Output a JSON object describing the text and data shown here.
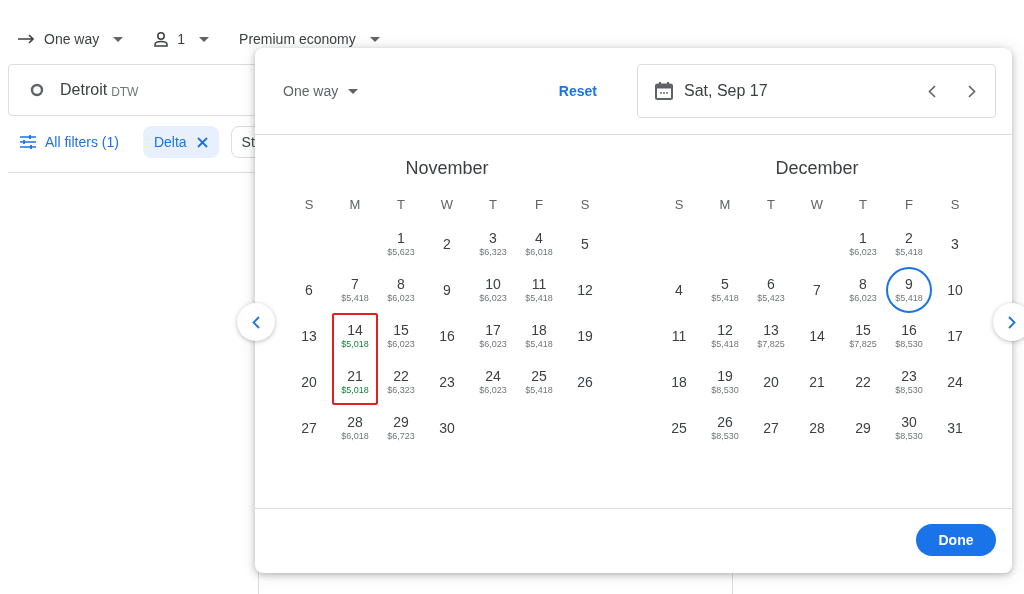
{
  "top_bar": {
    "trip_type": "One way",
    "passengers": "1",
    "cabin": "Premium economy"
  },
  "origin": {
    "city": "Detroit",
    "code": "DTW"
  },
  "filters": {
    "all_filters": "All filters (1)",
    "chips": [
      {
        "label": "Delta",
        "removable": true
      },
      {
        "label": "St",
        "removable": false
      }
    ]
  },
  "dialog": {
    "trip_type": "One way",
    "reset": "Reset",
    "date": "Sat, Sep 17",
    "done": "Done",
    "months": [
      {
        "name": "November",
        "weekdays": [
          "S",
          "M",
          "T",
          "W",
          "T",
          "F",
          "S"
        ],
        "weeks": [
          {
            "kind": "first",
            "days": [
              {
                "day": "1",
                "price": "$5,623",
                "cheap": false,
                "selected": false,
                "highlighted": false
              },
              {
                "day": "2",
                "selected": false,
                "highlighted": false
              },
              {
                "day": "3",
                "price": "$6,323",
                "cheap": false,
                "selected": false,
                "highlighted": false
              },
              {
                "day": "4",
                "price": "$6,018",
                "cheap": false,
                "selected": false,
                "highlighted": false
              },
              {
                "day": "5",
                "selected": false,
                "highlighted": false
              }
            ]
          },
          {
            "kind": "full",
            "days": [
              {
                "day": "6",
                "selected": false,
                "highlighted": false
              },
              {
                "day": "7",
                "price": "$5,418",
                "cheap": false,
                "selected": false,
                "highlighted": false
              },
              {
                "day": "8",
                "price": "$6,023",
                "cheap": false,
                "selected": false,
                "highlighted": false
              },
              {
                "day": "9",
                "selected": false,
                "highlighted": false
              },
              {
                "day": "10",
                "price": "$6,023",
                "cheap": false,
                "selected": false,
                "highlighted": false
              },
              {
                "day": "11",
                "price": "$5,418",
                "cheap": false,
                "selected": false,
                "highlighted": false
              },
              {
                "day": "12",
                "selected": false,
                "highlighted": false
              }
            ]
          },
          {
            "kind": "full",
            "days": [
              {
                "day": "13",
                "selected": false,
                "highlighted": false
              },
              {
                "day": "14",
                "price": "$5,018",
                "cheap": true,
                "selected": false,
                "highlighted": true
              },
              {
                "day": "15",
                "price": "$6,023",
                "cheap": false,
                "selected": false,
                "highlighted": false
              },
              {
                "day": "16",
                "selected": false,
                "highlighted": false
              },
              {
                "day": "17",
                "price": "$6,023",
                "cheap": false,
                "selected": false,
                "highlighted": false
              },
              {
                "day": "18",
                "price": "$5,418",
                "cheap": false,
                "selected": false,
                "highlighted": false
              },
              {
                "day": "19",
                "selected": false,
                "highlighted": false
              }
            ]
          },
          {
            "kind": "full",
            "days": [
              {
                "day": "20",
                "selected": false,
                "highlighted": false
              },
              {
                "day": "21",
                "price": "$5,018",
                "cheap": true,
                "selected": false,
                "highlighted": true
              },
              {
                "day": "22",
                "price": "$6,323",
                "cheap": false,
                "selected": false,
                "highlighted": false
              },
              {
                "day": "23",
                "selected": false,
                "highlighted": false
              },
              {
                "day": "24",
                "price": "$6,023",
                "cheap": false,
                "selected": false,
                "highlighted": false
              },
              {
                "day": "25",
                "price": "$5,418",
                "cheap": false,
                "selected": false,
                "highlighted": false
              },
              {
                "day": "26",
                "selected": false,
                "highlighted": false
              }
            ]
          },
          {
            "kind": "last",
            "days": [
              {
                "day": "27",
                "selected": false,
                "highlighted": false
              },
              {
                "day": "28",
                "price": "$6,018",
                "cheap": false,
                "selected": false,
                "highlighted": false
              },
              {
                "day": "29",
                "price": "$6,723",
                "cheap": false,
                "selected": false,
                "highlighted": false
              },
              {
                "day": "30",
                "selected": false,
                "highlighted": false
              }
            ]
          }
        ]
      },
      {
        "name": "December",
        "weekdays": [
          "S",
          "M",
          "T",
          "W",
          "T",
          "F",
          "S"
        ],
        "weeks": [
          {
            "kind": "first",
            "days": [
              {
                "day": "1",
                "price": "$6,023",
                "cheap": false,
                "selected": false,
                "highlighted": false
              },
              {
                "day": "2",
                "price": "$5,418",
                "cheap": false,
                "selected": false,
                "highlighted": false
              },
              {
                "day": "3",
                "selected": false,
                "highlighted": false
              }
            ]
          },
          {
            "kind": "full",
            "days": [
              {
                "day": "4",
                "selected": false,
                "highlighted": false
              },
              {
                "day": "5",
                "price": "$5,418",
                "cheap": false,
                "selected": false,
                "highlighted": false
              },
              {
                "day": "6",
                "price": "$5,423",
                "cheap": false,
                "selected": false,
                "highlighted": false
              },
              {
                "day": "7",
                "selected": false,
                "highlighted": false
              },
              {
                "day": "8",
                "price": "$6,023",
                "cheap": false,
                "selected": false,
                "highlighted": false
              },
              {
                "day": "9",
                "price": "$5,418",
                "cheap": false,
                "selected": true,
                "highlighted": false
              },
              {
                "day": "10",
                "selected": false,
                "highlighted": false
              }
            ]
          },
          {
            "kind": "full",
            "days": [
              {
                "day": "11",
                "selected": false,
                "highlighted": false
              },
              {
                "day": "12",
                "price": "$5,418",
                "cheap": false,
                "selected": false,
                "highlighted": false
              },
              {
                "day": "13",
                "price": "$7,825",
                "cheap": false,
                "selected": false,
                "highlighted": false
              },
              {
                "day": "14",
                "selected": false,
                "highlighted": false
              },
              {
                "day": "15",
                "price": "$7,825",
                "cheap": false,
                "selected": false,
                "highlighted": false
              },
              {
                "day": "16",
                "price": "$8,530",
                "cheap": false,
                "selected": false,
                "highlighted": false
              },
              {
                "day": "17",
                "selected": false,
                "highlighted": false
              }
            ]
          },
          {
            "kind": "full",
            "days": [
              {
                "day": "18",
                "selected": false,
                "highlighted": false
              },
              {
                "day": "19",
                "price": "$8,530",
                "cheap": false,
                "selected": false,
                "highlighted": false
              },
              {
                "day": "20",
                "selected": false,
                "highlighted": false
              },
              {
                "day": "21",
                "selected": false,
                "highlighted": false
              },
              {
                "day": "22",
                "selected": false,
                "highlighted": false
              },
              {
                "day": "23",
                "price": "$8,530",
                "cheap": false,
                "selected": false,
                "highlighted": false
              },
              {
                "day": "24",
                "selected": false,
                "highlighted": false
              }
            ]
          },
          {
            "kind": "last",
            "days": [
              {
                "day": "25",
                "selected": false,
                "highlighted": false
              },
              {
                "day": "26",
                "price": "$8,530",
                "cheap": false,
                "selected": false,
                "highlighted": false
              },
              {
                "day": "27",
                "selected": false,
                "highlighted": false
              },
              {
                "day": "28",
                "selected": false,
                "highlighted": false
              },
              {
                "day": "29",
                "selected": false,
                "highlighted": false
              },
              {
                "day": "30",
                "price": "$8,530",
                "cheap": false,
                "selected": false,
                "highlighted": false
              },
              {
                "day": "31",
                "selected": false,
                "highlighted": false
              }
            ]
          }
        ]
      }
    ]
  }
}
